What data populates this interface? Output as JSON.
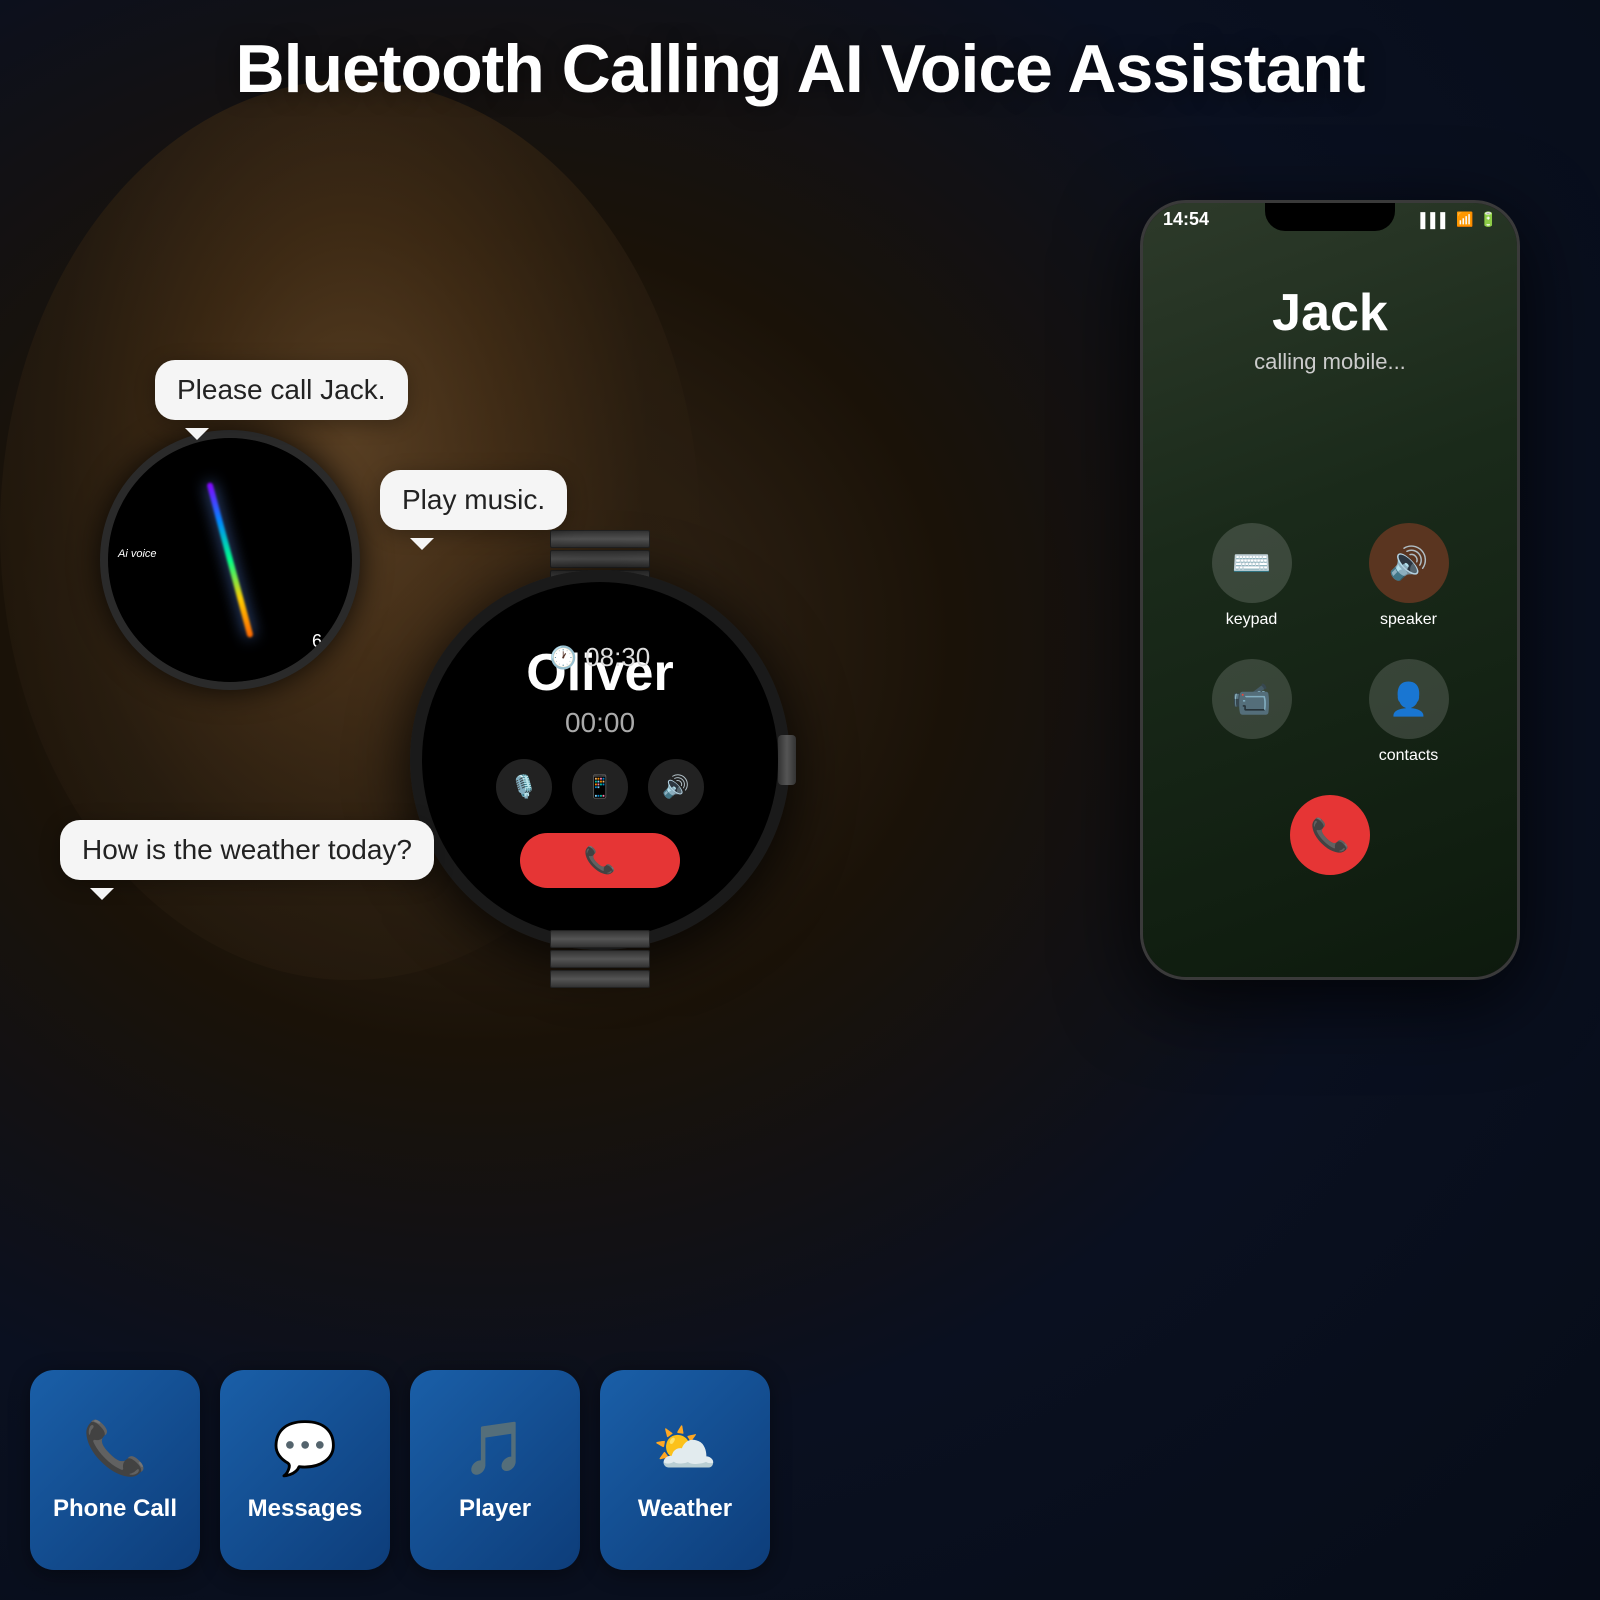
{
  "header": {
    "title": "Bluetooth Calling AI Voice Assistant"
  },
  "bubbles": {
    "call": "Please call Jack.",
    "music": "Play music.",
    "weather": "How is the weather today?"
  },
  "watch_wrist": {
    "ai_label": "Ai voice",
    "number": "6"
  },
  "watch_main": {
    "time": "08:30",
    "name": "Oliver",
    "duration": "00:00"
  },
  "phone": {
    "status_time": "14:54",
    "signal": "▌▌▌",
    "wifi": "WiFi",
    "battery": "🔋",
    "caller_name": "Jack",
    "caller_status": "calling mobile...",
    "controls": {
      "keypad_label": "keypad",
      "speaker_label": "speaker",
      "contacts_label": "contacts"
    }
  },
  "features": [
    {
      "icon": "📞",
      "label": "Phone Call"
    },
    {
      "icon": "💬",
      "label": "Messages"
    },
    {
      "icon": "🎵",
      "label": "Player"
    },
    {
      "icon": "⛅",
      "label": "Weather"
    }
  ],
  "colors": {
    "accent_blue": "#1a5fa8",
    "end_call_red": "#e63535",
    "watch_face": "#000000",
    "phone_bg_start": "#2d3a2a",
    "phone_bg_end": "#0d1a0d"
  }
}
